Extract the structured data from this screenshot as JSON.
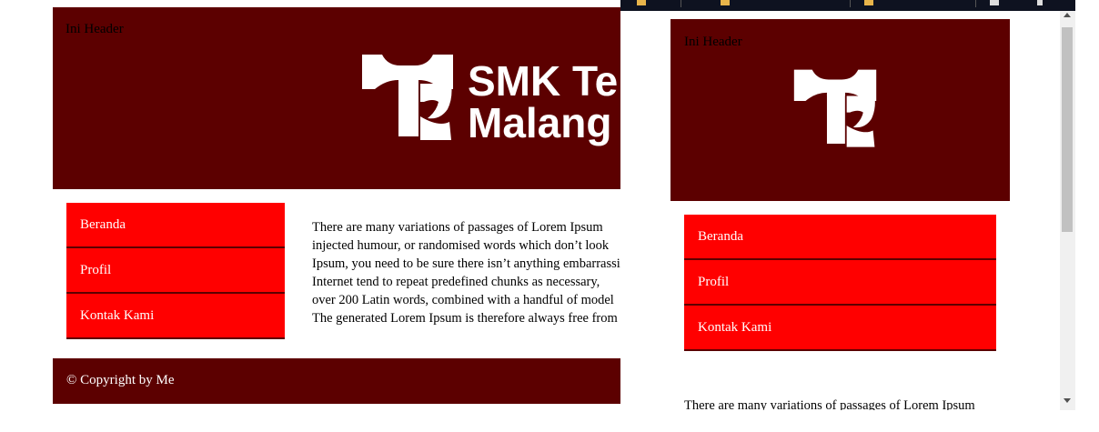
{
  "desktop": {
    "header": {
      "text": "Ini Header",
      "school_name_line1": "SMK Te",
      "school_name_line2": "Malang"
    },
    "nav": [
      {
        "label": "Beranda"
      },
      {
        "label": "Profil"
      },
      {
        "label": "Kontak Kami"
      }
    ],
    "content": {
      "lines": [
        "There are many variations of passages of Lorem Ipsum",
        "injected humour, or randomised words which don’t look",
        "Ipsum, you need to be sure there isn’t anything embarrassing",
        "Internet tend to repeat predefined chunks as necessary,",
        "over 200 Latin words, combined with a handful of model",
        "The generated Lorem Ipsum is therefore always free from"
      ]
    },
    "footer": {
      "text": "© Copyright by Me"
    }
  },
  "mobile": {
    "header": {
      "text": "Ini Header"
    },
    "nav": [
      {
        "label": "Beranda"
      },
      {
        "label": "Profil"
      },
      {
        "label": "Kontak Kami"
      }
    ],
    "content": {
      "first_line": "There are many variations of passages of Lorem Ipsum"
    }
  },
  "colors": {
    "header_bg": "#5c0000",
    "nav_bg": "#ff0000",
    "text_light": "#ffffff"
  },
  "icons": [
    "ts-logo",
    "scroll-up-arrow",
    "scroll-down-arrow"
  ]
}
